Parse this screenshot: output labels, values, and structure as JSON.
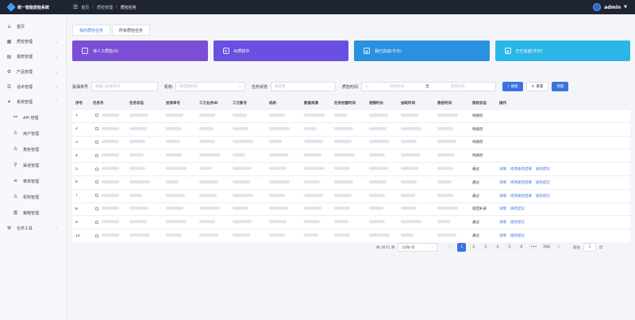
{
  "app": {
    "title": "统一智能质检系统",
    "user_name": "admin"
  },
  "breadcrumb": {
    "items": [
      "首页",
      "质检管理",
      "质检任务"
    ]
  },
  "sidebar": {
    "items": [
      {
        "label": "首页",
        "icon": "home-icon",
        "name": "home"
      },
      {
        "label": "质检管理",
        "icon": "grid-icon",
        "name": "inspection",
        "chevron": true
      },
      {
        "label": "报表管理",
        "icon": "report-icon",
        "name": "report",
        "chevron": true
      },
      {
        "label": "产品管理",
        "icon": "gear-icon",
        "name": "product",
        "chevron": true
      },
      {
        "label": "话术管理",
        "icon": "script-icon",
        "name": "script",
        "chevron": true
      },
      {
        "label": "系统管理",
        "icon": "settings-icon",
        "name": "system",
        "chevron": true,
        "expanded": true
      }
    ],
    "sub_items": [
      {
        "label": "API 管理",
        "icon": "api-icon",
        "name": "api"
      },
      {
        "label": "用户管理",
        "icon": "user-icon",
        "name": "users"
      },
      {
        "label": "角色管理",
        "icon": "role-icon",
        "name": "roles"
      },
      {
        "label": "渠道管理",
        "icon": "channel-icon",
        "name": "channels"
      },
      {
        "label": "菜单管理",
        "icon": "menu-icon",
        "name": "menus"
      },
      {
        "label": "机构管理",
        "icon": "org-icon",
        "name": "orgs"
      },
      {
        "label": "策略管理",
        "icon": "policy-icon",
        "name": "policies"
      }
    ],
    "bottom_item": {
      "label": "业务工具",
      "icon": "tool-icon",
      "name": "tools"
    }
  },
  "tabs": [
    {
      "label": "我的质检任务",
      "active": true
    },
    {
      "label": "所有质检任务",
      "active": false
    }
  ],
  "cards": [
    {
      "label": "待人工质检(0)",
      "icon": "user-check-icon",
      "color": "#7a4fd6"
    },
    {
      "label": "AI质检中",
      "icon": "ai-icon",
      "color": "#6a4fe0"
    },
    {
      "label": "我已完成(今日)",
      "icon": "calendar-check-icon",
      "color": "#2a90e0"
    },
    {
      "label": "已已完成(今日)",
      "icon": "calendar-icon",
      "color": "#2cb6e8"
    }
  ],
  "filters": {
    "policy_no_label": "投保单号",
    "policy_no_placeholder": "请输入投保单号",
    "org_label": "机构",
    "org_placeholder": "请选择机构",
    "status_label": "任务状态",
    "status_placeholder": "请选择",
    "time_label": "质检时间",
    "start_placeholder": "开始时间",
    "range_sep": "至",
    "end_placeholder": "结束时间",
    "search_button": "搜索",
    "reset_button": "重置",
    "claim_button": "领取"
  },
  "table": {
    "columns": [
      "序号",
      "任务号",
      "任务状态",
      "投保单号",
      "三方业务ID",
      "三方账号",
      "机构",
      "数据来源",
      "任务创建时间",
      "视频时长",
      "抽取时间",
      "质检时间",
      "质检状态",
      "操作"
    ],
    "rows": [
      {
        "no": "1",
        "status": "待质检",
        "actions": []
      },
      {
        "no": "2",
        "status": "待质检",
        "actions": []
      },
      {
        "no": "3",
        "status": "待质检",
        "actions": []
      },
      {
        "no": "4",
        "status": "待质检",
        "actions": []
      },
      {
        "no": "5",
        "status": "通过",
        "actions": [
          "详情",
          "修改质检结果",
          "质检结论"
        ]
      },
      {
        "no": "6",
        "status": "通过",
        "actions": [
          "详情",
          "修改质检结果",
          "质检结论"
        ]
      },
      {
        "no": "7",
        "status": "通过",
        "actions": [
          "详情",
          "修改质检结果",
          "质检结论"
        ]
      },
      {
        "no": "8",
        "status": "驳回补录",
        "actions": [
          "详情",
          "质检结论"
        ]
      },
      {
        "no": "9",
        "status": "通过",
        "actions": [
          "详情",
          "质检结论"
        ]
      },
      {
        "no": "10",
        "status": "通过",
        "actions": [
          "详情",
          "质检结论"
        ]
      }
    ]
  },
  "pagination": {
    "total_text": "共 2671 条",
    "page_size": "10条/页",
    "pages": [
      "1",
      "2",
      "3",
      "4",
      "5",
      "6",
      "•••",
      "268"
    ],
    "current": "1",
    "goto_label": "前往",
    "goto_value": "1",
    "page_unit": "页"
  }
}
